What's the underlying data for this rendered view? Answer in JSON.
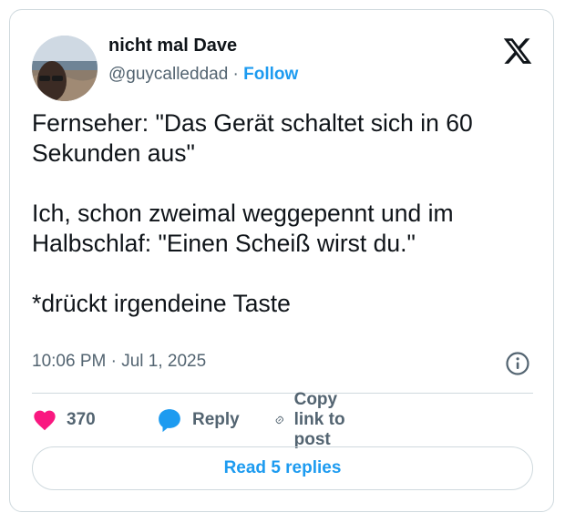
{
  "author": {
    "name": "nicht mal Dave",
    "handle": "@guycalleddad",
    "separator": "·",
    "follow_label": "Follow"
  },
  "tweet": {
    "text": "Fernseher: \"Das Gerät schaltet sich in 60 Sekunden aus\"\n\nIch, schon zweimal weggepennt und im Halbschlaf: \"Einen Scheiß wirst du.\"\n\n*drückt irgendeine Taste",
    "timestamp": "10:06 PM · Jul 1, 2025"
  },
  "actions": {
    "like_count": "370",
    "reply_label": "Reply",
    "copy_label": "Copy link to post"
  },
  "read_replies_label": "Read 5 replies",
  "icons": {
    "brand": "x-logo-icon",
    "like": "heart-icon",
    "reply": "speech-bubble-icon",
    "copy": "link-icon",
    "info": "info-icon"
  },
  "colors": {
    "like": "#f91880",
    "accent": "#1d9bf0",
    "muted": "#536471",
    "border": "#cfd9de"
  }
}
